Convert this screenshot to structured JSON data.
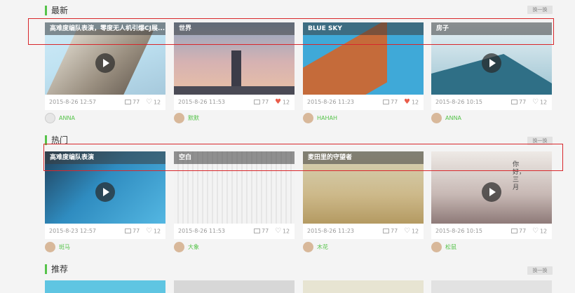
{
  "sections": [
    {
      "title": "最新",
      "swap": "换一换"
    },
    {
      "title": "热门",
      "swap": "换一换"
    },
    {
      "title": "推荐",
      "swap": "换一换"
    }
  ],
  "latest": [
    {
      "caption": "高难度编队表演，零度无人机引爆CJ展...",
      "date": "2015-8-26  12:57",
      "comments": "77",
      "likes": "12",
      "liked": false,
      "user": "ANNA",
      "video": true
    },
    {
      "caption": "世界",
      "date": "2015-8-26  11:53",
      "comments": "77",
      "likes": "12",
      "liked": true,
      "user": "默默",
      "video": false
    },
    {
      "caption": "BLUE SKY",
      "date": "2015-8-26  11:23",
      "comments": "77",
      "likes": "12",
      "liked": true,
      "user": "HAHAH",
      "video": false
    },
    {
      "caption": "房子",
      "date": "2015-8-26  10:15",
      "comments": "77",
      "likes": "12",
      "liked": false,
      "user": "ANNA",
      "video": true
    }
  ],
  "hot": [
    {
      "caption": "高难度编队表演",
      "date": "2015-8-23  12:57",
      "comments": "77",
      "likes": "12",
      "liked": false,
      "user": "斑马",
      "video": true
    },
    {
      "caption": "空白",
      "date": "2015-8-26  11:53",
      "comments": "77",
      "likes": "12",
      "liked": false,
      "user": "大象",
      "video": false
    },
    {
      "caption": "麦田里的守望者",
      "date": "2015-8-26  11:23",
      "comments": "77",
      "likes": "12",
      "liked": false,
      "user": "木花",
      "video": false
    },
    {
      "caption": "",
      "date": "2015-8-26  10:15",
      "comments": "77",
      "likes": "12",
      "liked": false,
      "user": "松鼠",
      "video": true,
      "poem": "你好，三月"
    }
  ],
  "colors": {
    "accent": "#56c34a",
    "liked": "#e95c4a",
    "annotation": "#d8272b"
  }
}
